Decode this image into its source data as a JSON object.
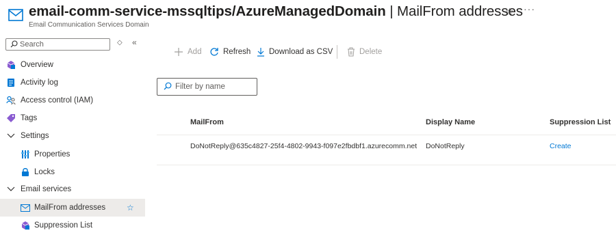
{
  "header": {
    "resource_name": "email-comm-service-mssqltips/AzureManagedDomain",
    "separator": " | ",
    "page_name": "MailFrom addresses",
    "subtitle": "Email Communication Services Domain",
    "icon": "mail-icon",
    "favorite_icon": "star-icon",
    "more_label": "···"
  },
  "sidebar": {
    "search_placeholder": "Search",
    "items": [
      {
        "label": "Overview",
        "icon": "overview-icon"
      },
      {
        "label": "Activity log",
        "icon": "activity-log-icon"
      },
      {
        "label": "Access control (IAM)",
        "icon": "iam-icon"
      },
      {
        "label": "Tags",
        "icon": "tag-icon"
      },
      {
        "label": "Settings",
        "icon": "chevron-down-icon"
      },
      {
        "label": "Properties",
        "icon": "properties-icon"
      },
      {
        "label": "Locks",
        "icon": "lock-icon"
      },
      {
        "label": "Email services",
        "icon": "chevron-down-icon"
      },
      {
        "label": "MailFrom addresses",
        "icon": "mail-icon",
        "active": true
      },
      {
        "label": "Suppression List",
        "icon": "suppression-icon"
      }
    ]
  },
  "toolbar": {
    "add_label": "Add",
    "refresh_label": "Refresh",
    "download_label": "Download as CSV",
    "delete_label": "Delete"
  },
  "filter": {
    "placeholder": "Filter by name"
  },
  "table": {
    "columns": [
      "MailFrom",
      "Display Name",
      "Suppression List"
    ],
    "rows": [
      {
        "mailfrom": "DoNotReply@635c4827-25f4-4802-9943-f097e2fbdbf1.azurecomm.net",
        "display_name": "DoNotReply",
        "suppression": "Create"
      }
    ]
  },
  "colors": {
    "accent": "#0078d4",
    "active_bg": "#edebe9",
    "disabled": "#a19f9d"
  }
}
